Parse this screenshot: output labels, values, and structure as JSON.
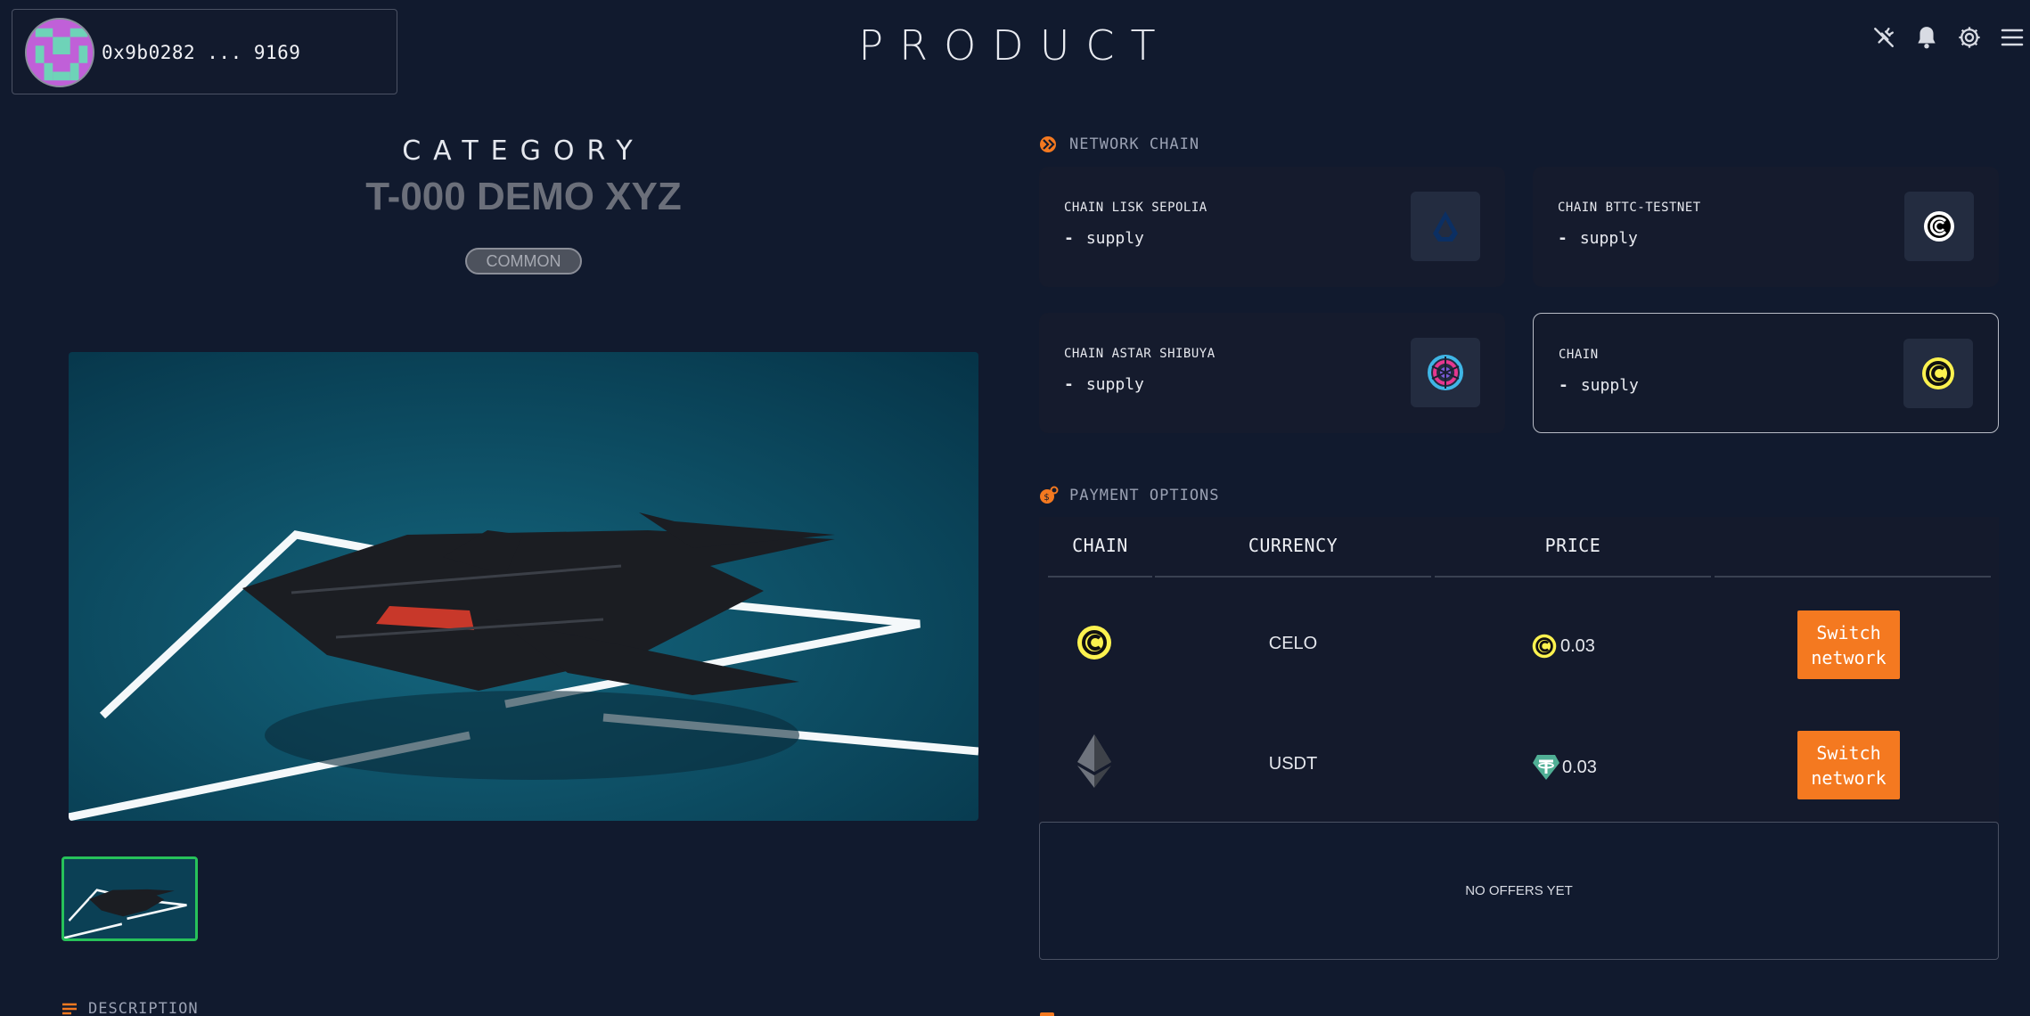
{
  "header": {
    "title": "PRODUCT",
    "wallet_address": "0x9b0282 ... 9169",
    "icons": [
      "disconnect-icon",
      "bell-icon",
      "gear-icon",
      "menu-icon"
    ]
  },
  "product": {
    "category_label": "CATEGORY",
    "name": "T-000 DEMO XYZ",
    "rarity": "COMMON"
  },
  "description": {
    "label": "DESCRIPTION"
  },
  "network": {
    "label": "NETWORK CHAIN",
    "chains": [
      {
        "name": "CHAIN LISK SEPOLIA",
        "supply_value": "-",
        "supply_label": "supply",
        "icon": "lisk-icon"
      },
      {
        "name": "CHAIN BTTC-TESTNET",
        "supply_value": "-",
        "supply_label": "supply",
        "icon": "bttc-icon"
      },
      {
        "name": "CHAIN ASTAR SHIBUYA",
        "supply_value": "-",
        "supply_label": "supply",
        "icon": "astar-icon"
      },
      {
        "name": "CHAIN",
        "supply_value": "-",
        "supply_label": "supply",
        "icon": "celo-icon"
      }
    ]
  },
  "payment": {
    "label": "PAYMENT OPTIONS",
    "columns": [
      "CHAIN",
      "CURRENCY",
      "PRICE"
    ],
    "rows": [
      {
        "chain_icon": "celo-icon",
        "currency": "CELO",
        "price_icon": "celo-icon",
        "price": "0.03",
        "action": "Switch network"
      },
      {
        "chain_icon": "ethereum-icon",
        "currency": "USDT",
        "price_icon": "tether-icon",
        "price": "0.03",
        "action": "Switch network"
      }
    ]
  },
  "offers": {
    "empty_text": "NO OFFERS YET"
  },
  "colors": {
    "background": "#111a2e",
    "card": "#151b2d",
    "accent_button": "#f47920",
    "thumb_selected": "#27c25a",
    "celo_yellow": "#fcf24f"
  }
}
